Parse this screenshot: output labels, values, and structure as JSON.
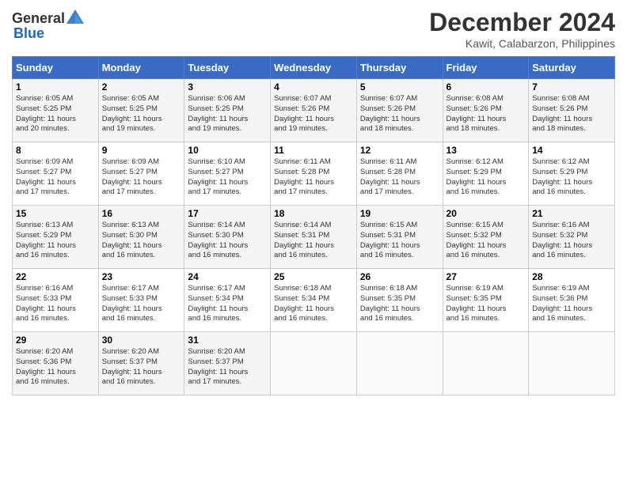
{
  "logo": {
    "line1": "General",
    "line2": "Blue"
  },
  "title": "December 2024",
  "subtitle": "Kawit, Calabarzon, Philippines",
  "days_of_week": [
    "Sunday",
    "Monday",
    "Tuesday",
    "Wednesday",
    "Thursday",
    "Friday",
    "Saturday"
  ],
  "weeks": [
    [
      {
        "day": 1,
        "info": "Sunrise: 6:05 AM\nSunset: 5:25 PM\nDaylight: 11 hours\nand 20 minutes."
      },
      {
        "day": 2,
        "info": "Sunrise: 6:05 AM\nSunset: 5:25 PM\nDaylight: 11 hours\nand 19 minutes."
      },
      {
        "day": 3,
        "info": "Sunrise: 6:06 AM\nSunset: 5:25 PM\nDaylight: 11 hours\nand 19 minutes."
      },
      {
        "day": 4,
        "info": "Sunrise: 6:07 AM\nSunset: 5:26 PM\nDaylight: 11 hours\nand 19 minutes."
      },
      {
        "day": 5,
        "info": "Sunrise: 6:07 AM\nSunset: 5:26 PM\nDaylight: 11 hours\nand 18 minutes."
      },
      {
        "day": 6,
        "info": "Sunrise: 6:08 AM\nSunset: 5:26 PM\nDaylight: 11 hours\nand 18 minutes."
      },
      {
        "day": 7,
        "info": "Sunrise: 6:08 AM\nSunset: 5:26 PM\nDaylight: 11 hours\nand 18 minutes."
      }
    ],
    [
      {
        "day": 8,
        "info": "Sunrise: 6:09 AM\nSunset: 5:27 PM\nDaylight: 11 hours\nand 17 minutes."
      },
      {
        "day": 9,
        "info": "Sunrise: 6:09 AM\nSunset: 5:27 PM\nDaylight: 11 hours\nand 17 minutes."
      },
      {
        "day": 10,
        "info": "Sunrise: 6:10 AM\nSunset: 5:27 PM\nDaylight: 11 hours\nand 17 minutes."
      },
      {
        "day": 11,
        "info": "Sunrise: 6:11 AM\nSunset: 5:28 PM\nDaylight: 11 hours\nand 17 minutes."
      },
      {
        "day": 12,
        "info": "Sunrise: 6:11 AM\nSunset: 5:28 PM\nDaylight: 11 hours\nand 17 minutes."
      },
      {
        "day": 13,
        "info": "Sunrise: 6:12 AM\nSunset: 5:29 PM\nDaylight: 11 hours\nand 16 minutes."
      },
      {
        "day": 14,
        "info": "Sunrise: 6:12 AM\nSunset: 5:29 PM\nDaylight: 11 hours\nand 16 minutes."
      }
    ],
    [
      {
        "day": 15,
        "info": "Sunrise: 6:13 AM\nSunset: 5:29 PM\nDaylight: 11 hours\nand 16 minutes."
      },
      {
        "day": 16,
        "info": "Sunrise: 6:13 AM\nSunset: 5:30 PM\nDaylight: 11 hours\nand 16 minutes."
      },
      {
        "day": 17,
        "info": "Sunrise: 6:14 AM\nSunset: 5:30 PM\nDaylight: 11 hours\nand 16 minutes."
      },
      {
        "day": 18,
        "info": "Sunrise: 6:14 AM\nSunset: 5:31 PM\nDaylight: 11 hours\nand 16 minutes."
      },
      {
        "day": 19,
        "info": "Sunrise: 6:15 AM\nSunset: 5:31 PM\nDaylight: 11 hours\nand 16 minutes."
      },
      {
        "day": 20,
        "info": "Sunrise: 6:15 AM\nSunset: 5:32 PM\nDaylight: 11 hours\nand 16 minutes."
      },
      {
        "day": 21,
        "info": "Sunrise: 6:16 AM\nSunset: 5:32 PM\nDaylight: 11 hours\nand 16 minutes."
      }
    ],
    [
      {
        "day": 22,
        "info": "Sunrise: 6:16 AM\nSunset: 5:33 PM\nDaylight: 11 hours\nand 16 minutes."
      },
      {
        "day": 23,
        "info": "Sunrise: 6:17 AM\nSunset: 5:33 PM\nDaylight: 11 hours\nand 16 minutes."
      },
      {
        "day": 24,
        "info": "Sunrise: 6:17 AM\nSunset: 5:34 PM\nDaylight: 11 hours\nand 16 minutes."
      },
      {
        "day": 25,
        "info": "Sunrise: 6:18 AM\nSunset: 5:34 PM\nDaylight: 11 hours\nand 16 minutes."
      },
      {
        "day": 26,
        "info": "Sunrise: 6:18 AM\nSunset: 5:35 PM\nDaylight: 11 hours\nand 16 minutes."
      },
      {
        "day": 27,
        "info": "Sunrise: 6:19 AM\nSunset: 5:35 PM\nDaylight: 11 hours\nand 16 minutes."
      },
      {
        "day": 28,
        "info": "Sunrise: 6:19 AM\nSunset: 5:36 PM\nDaylight: 11 hours\nand 16 minutes."
      }
    ],
    [
      {
        "day": 29,
        "info": "Sunrise: 6:20 AM\nSunset: 5:36 PM\nDaylight: 11 hours\nand 16 minutes."
      },
      {
        "day": 30,
        "info": "Sunrise: 6:20 AM\nSunset: 5:37 PM\nDaylight: 11 hours\nand 16 minutes."
      },
      {
        "day": 31,
        "info": "Sunrise: 6:20 AM\nSunset: 5:37 PM\nDaylight: 11 hours\nand 17 minutes."
      },
      null,
      null,
      null,
      null
    ]
  ]
}
